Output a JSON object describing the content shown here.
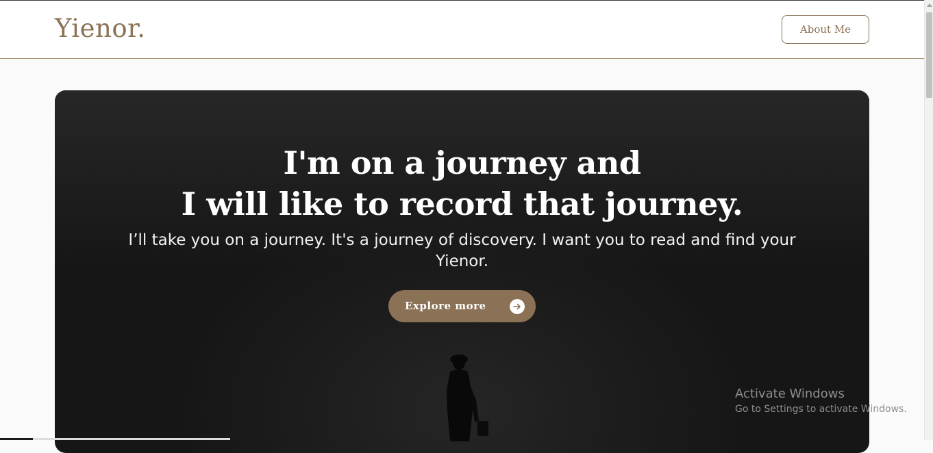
{
  "header": {
    "logo": "Yienor.",
    "about_label": "About Me"
  },
  "hero": {
    "title_line1": "I'm on a journey and",
    "title_line2": "I will like to record that journey.",
    "subtitle": "I’ll take you on a journey. It's a journey of discovery. I want you to read and find your Yienor.",
    "button_label": "Explore more",
    "button_icon": "arrow-right-icon"
  },
  "watermark": {
    "title": "Activate Windows",
    "subtitle": "Go to Settings to activate Windows."
  },
  "colors": {
    "brand": "#8b7155",
    "hero_bg": "#1e1e1e",
    "header_bg": "#ffffff"
  }
}
